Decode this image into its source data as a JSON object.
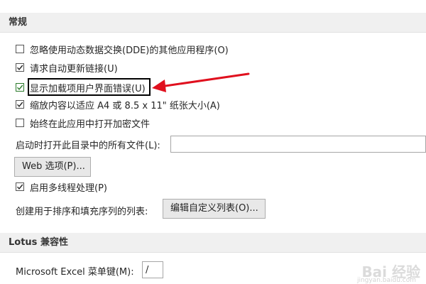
{
  "sections": {
    "general_title": "常规",
    "lotus_title": "Lotus 兼容性"
  },
  "options": [
    {
      "label": "忽略使用动态数据交换(DDE)的其他应用程序(O)",
      "checked": false
    },
    {
      "label": "请求自动更新链接(U)",
      "checked": true
    },
    {
      "label": "显示加载项用户界面错误(U)",
      "checked": true
    },
    {
      "label": "缩放内容以适应 A4 或 8.5 x 11\" 纸张大小(A)",
      "checked": true
    },
    {
      "label": "始终在此应用中打开加密文件",
      "checked": false
    }
  ],
  "startup": {
    "label": "启动时打开此目录中的所有文件(L):",
    "value": ""
  },
  "web_button": "Web 选项(P)...",
  "multithread": {
    "label": "启用多线程处理(P)",
    "checked": true
  },
  "custom_lists": {
    "label": "创建用于排序和填充序列的列表:",
    "button": "编辑自定义列表(O)..."
  },
  "lotus": {
    "menu_key_label": "Microsoft Excel 菜单键(M):",
    "menu_key_value": "/"
  },
  "annotation": {
    "arrow_color": "#e0101e",
    "box_color": "#000000"
  },
  "watermark": {
    "brand": "Bai 经验",
    "url": "jingyan.baidu.com"
  }
}
